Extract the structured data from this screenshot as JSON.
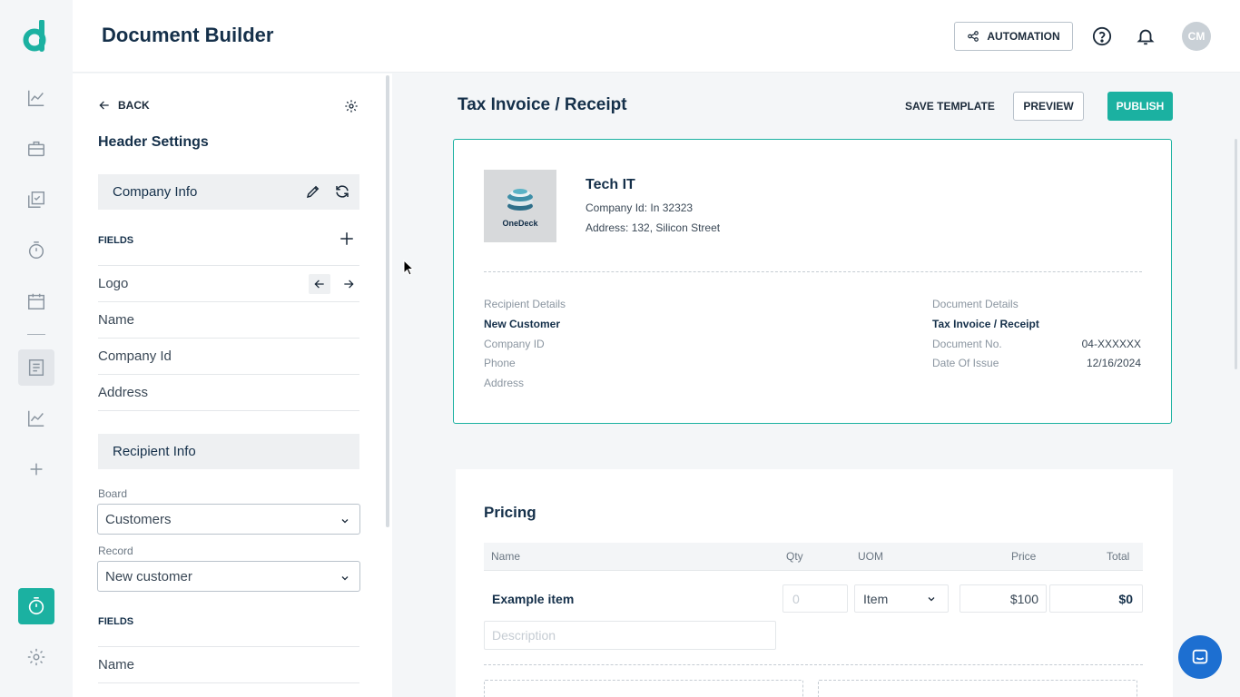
{
  "app": {
    "title": "Document Builder",
    "brand_color": "#1bb1a1",
    "automation_label": "AUTOMATION",
    "user_initials": "CM"
  },
  "rail": {
    "items": [
      "analytics-icon",
      "briefcase-icon",
      "checklist-icon",
      "timer-icon",
      "calendar-icon",
      "document-icon",
      "chart-icon",
      "add-icon",
      "stopwatch-icon",
      "settings-icon"
    ],
    "active": "document-icon"
  },
  "panel": {
    "back_label": "BACK",
    "title": "Header Settings",
    "company_section": "Company Info",
    "fields_label": "FIELDS",
    "fields": [
      "Logo",
      "Name",
      "Company Id",
      "Address"
    ],
    "recipient_section": "Recipient Info",
    "board_label": "Board",
    "board_value": "Customers",
    "record_label": "Record",
    "record_value": "New customer",
    "fields_label_2": "FIELDS",
    "recipient_fields": [
      "Name"
    ]
  },
  "toolbar": {
    "doc_title": "Tax Invoice / Receipt",
    "save_template": "SAVE TEMPLATE",
    "preview": "PREVIEW",
    "publish": "PUBLISH"
  },
  "header_card": {
    "logo_text": "OneDeck",
    "company_name": "Tech IT",
    "company_id_label": "Company Id:",
    "company_id_value": "In 32323",
    "address_label": "Address:",
    "address_value": "132, Silicon Street",
    "recipient_heading": "Recipient Details",
    "recipient_name": "New Customer",
    "recipient_fields": [
      "Company ID",
      "Phone",
      "Address"
    ],
    "document_heading": "Document Details",
    "document_name": "Tax Invoice / Receipt",
    "doc_no_label": "Document No.",
    "doc_no_value": "04-XXXXXX",
    "date_label": "Date Of Issue",
    "date_value": "12/16/2024"
  },
  "pricing": {
    "title": "Pricing",
    "columns": [
      "Name",
      "Qty",
      "UOM",
      "Price",
      "Total"
    ],
    "item_name": "Example item",
    "qty_placeholder": "0",
    "uom": "Item",
    "price": "$100",
    "total": "$0",
    "description_placeholder": "Description"
  }
}
